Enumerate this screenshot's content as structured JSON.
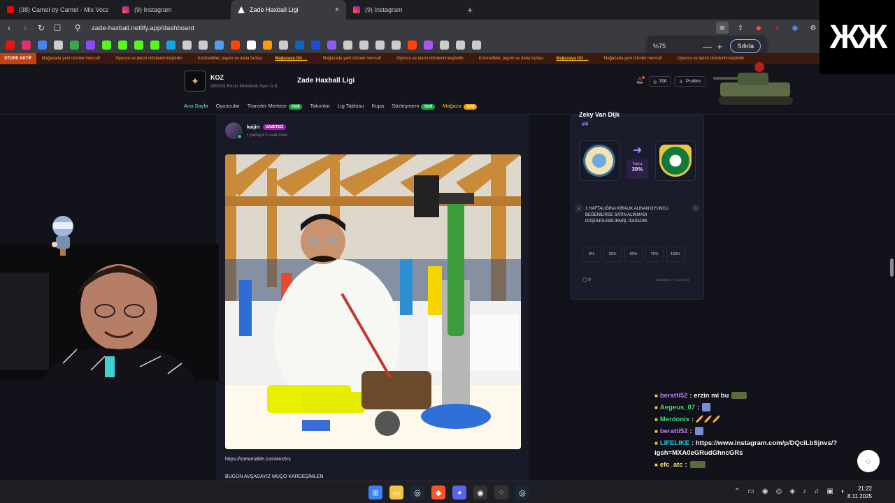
{
  "browser": {
    "tabs": [
      {
        "title": "(38) Camel by Camel - Mix Vocal - Yo",
        "favicon_color": "#ff0000",
        "active": false
      },
      {
        "title": "(9) Instagram",
        "favicon_color": "#e1306c",
        "active": false
      },
      {
        "title": "Zade Haxball Ligi",
        "favicon_color": "#ffffff",
        "active": true
      },
      {
        "title": "(9) Instagram",
        "favicon_color": "#e1306c",
        "active": false
      }
    ],
    "new_tab": "+",
    "close_tab": "×",
    "url": "zade-haxball.netlify.app/dashboard",
    "zoom": {
      "value": "%75",
      "minus": "—",
      "plus": "+",
      "reset": "Sıfırla"
    }
  },
  "ticker": {
    "live_label": "STORE AKTİF",
    "items": [
      {
        "text": "Mağazada yeni ürünler mevcut!",
        "link": ""
      },
      {
        "text": "Oyuncu ve takım ürünlerini keşfedin",
        "link": ""
      },
      {
        "text": "Kozmetikler, payon ve daha fazlası",
        "link": "Mağazaya Git →"
      },
      {
        "text": "Mağazada yeni ürünler mevcut!",
        "link": ""
      },
      {
        "text": "Oyuncu ve takım ürünlerini keşfedin",
        "link": ""
      },
      {
        "text": "Kozmetikler, payon ve daha fazlası",
        "link": "Mağazaya Git →"
      },
      {
        "text": "Mağazada yeni ürünler mevcut!",
        "link": ""
      },
      {
        "text": "Oyuncu ve takım ürünlerini keşfedin",
        "link": ""
      }
    ]
  },
  "header": {
    "club_name": "KOZ",
    "club_sub": "ZEDAŞ Kozlu Mendirek Spor A.Ş.",
    "site_title": "Zade Haxball Ligi",
    "coins": "700",
    "profile": "Profilim",
    "nav": [
      {
        "label": "Ana Sayfa",
        "badge": "",
        "active": true
      },
      {
        "label": "Oyuncular",
        "badge": "",
        "active": false
      },
      {
        "label": "Transfer Merkezi",
        "badge": "YENİ",
        "active": false
      },
      {
        "label": "Takımlar",
        "badge": "",
        "active": false
      },
      {
        "label": "Lig Tablosu",
        "badge": "",
        "active": false
      },
      {
        "label": "Kupa",
        "badge": "",
        "active": false
      },
      {
        "label": "Sözleşmem",
        "badge": "YENİ",
        "active": false
      },
      {
        "label": "Mağaza",
        "badge": "YENİ",
        "active": false
      }
    ]
  },
  "post": {
    "author": "kaijiri",
    "role_badge": "GAZETECİ",
    "time": "• yaklaşık 1 saat önce",
    "link": "https://streamable.com/4nx5rs",
    "text": "BUGÜN AVŞADAYIZ MUÇO KARDEŞİMLEN"
  },
  "transfer_card": {
    "player_name": "Zeky Van Dijk",
    "number": "#4",
    "rate_label": "Tutma",
    "rate_value": "39%",
    "description": "1 HAFTALIĞINA KİRALIK ALINAN OYUNCU BEĞENİLİRSE SATIN ALINMASI DÜŞÜNÜLEBİLİRMİŞ, İDDİADIR.",
    "percent_options": [
      "0%",
      "25%",
      "50%",
      "75%",
      "100%"
    ],
    "comments": "0",
    "meta": "zeki33ama • 1 gün önce",
    "prev": "‹",
    "next": "›"
  },
  "chat": [
    {
      "user": "beratti52",
      "text": ": erzin mi bu",
      "color_class": "u1",
      "emote": "tank"
    },
    {
      "user": "Aegeus_07",
      "text": ":",
      "color_class": "u2",
      "emote": "box"
    },
    {
      "user": "Merdonis",
      "text": ": 🥖🥖🥖",
      "color_class": "u2",
      "emote": ""
    },
    {
      "user": "beratti52",
      "text": ":",
      "color_class": "u1",
      "emote": "box"
    },
    {
      "user": "LIFELIKE",
      "text": ": https://www.instagram.com/p/DQciLbSjnvs/?igsh=MXA0eGRudGhncGRs",
      "color_class": "u3",
      "emote": ""
    },
    {
      "user": "efc_atc",
      "text": ":",
      "color_class": "u4",
      "emote": "tank"
    }
  ],
  "clock": {
    "time": "21:22",
    "date": "8.11.2025"
  }
}
